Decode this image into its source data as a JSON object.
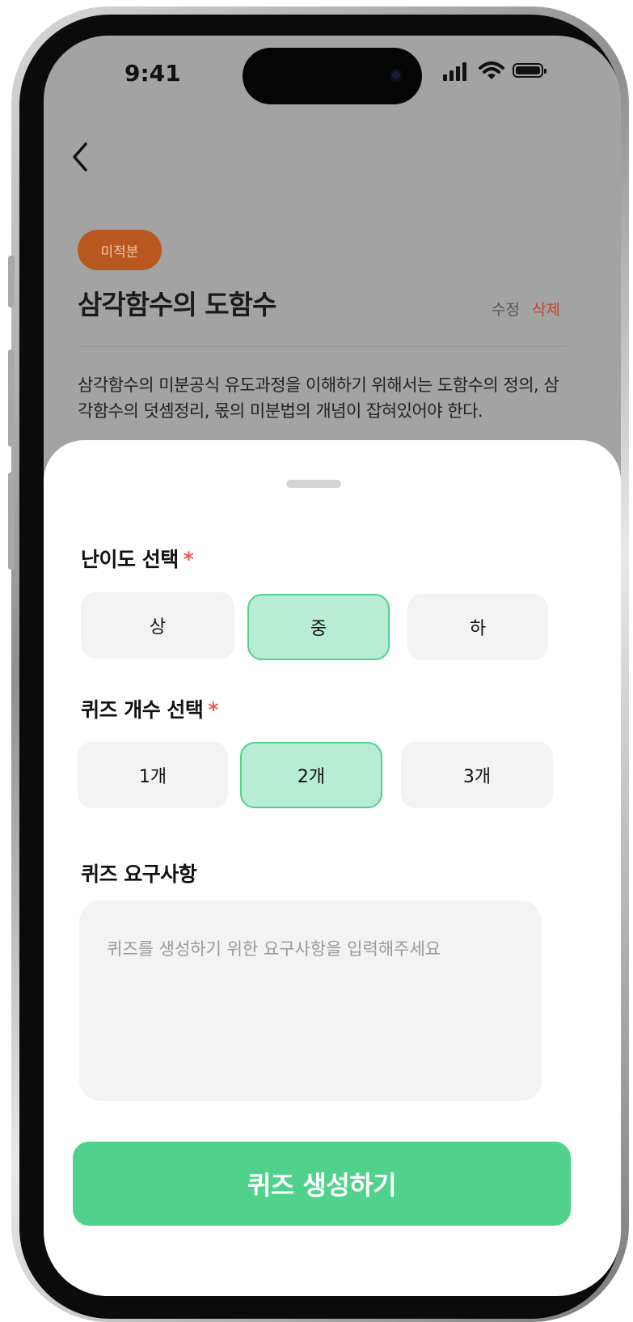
{
  "status_bar": {
    "time": "9:41"
  },
  "header": {
    "back_icon": "chevron-left-icon"
  },
  "topic": {
    "badge": "미적분",
    "title": "삼각함수의 도함수",
    "edit_label": "수정",
    "delete_label": "삭제",
    "description": "삼각함수의 미분공식 유도과정을 이해하기 위해서는 도함수의 정의, 삼각함수의 덧셈정리, 몫의 미분법의 개념이 잡혀있어야 한다."
  },
  "sheet": {
    "difficulty": {
      "label": "난이도 선택",
      "required_mark": "*",
      "options": [
        "상",
        "중",
        "하"
      ],
      "selected": "중"
    },
    "quiz_count": {
      "label": "퀴즈 개수 선택",
      "required_mark": "*",
      "options": [
        "1개",
        "2개",
        "3개"
      ],
      "selected": "2개"
    },
    "requirements": {
      "label": "퀴즈 요구사항",
      "placeholder": "퀴즈를 생성하기 위한 요구사항을 입력해주세요",
      "value": ""
    },
    "submit_label": "퀴즈 생성하기"
  },
  "colors": {
    "accent": "#50d28c",
    "selected_bg": "#b8ecd5",
    "badge_bg": "#b8581f",
    "required": "#ef5b50",
    "delete": "#c0442f"
  }
}
